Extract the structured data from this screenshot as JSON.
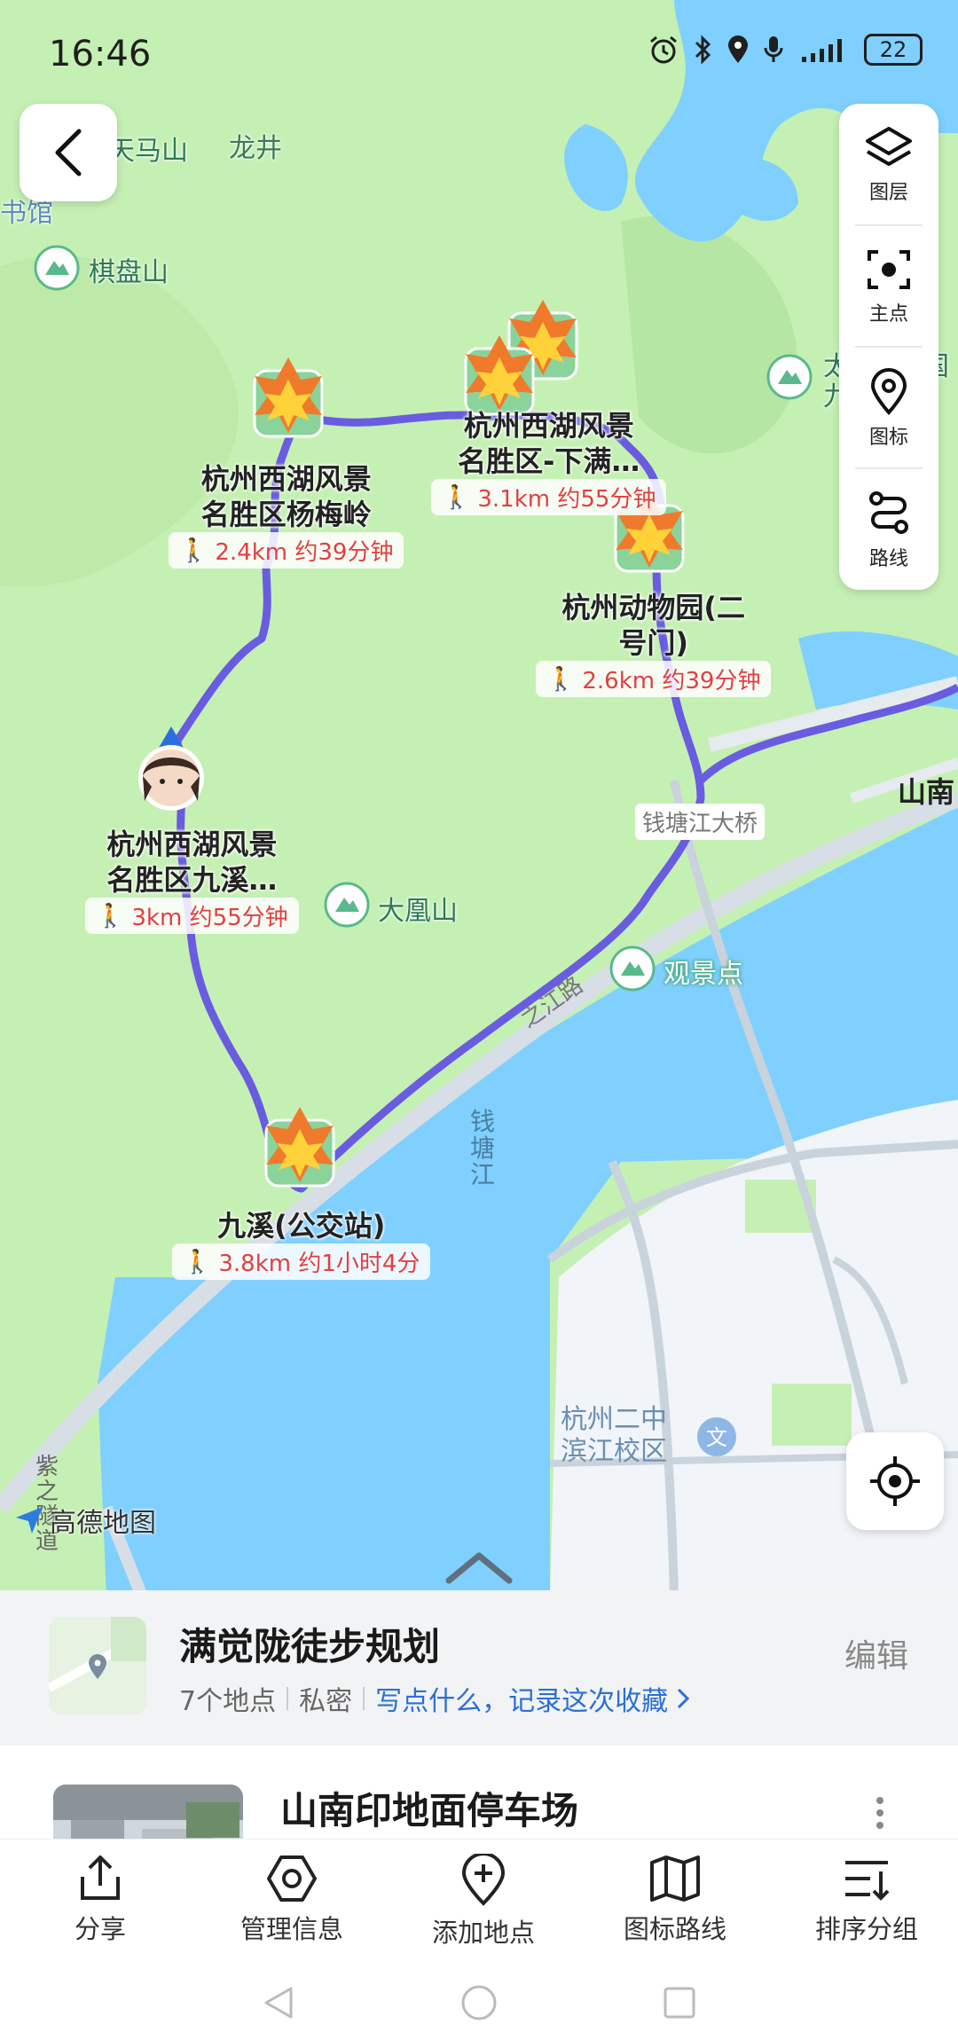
{
  "status_bar": {
    "time": "16:46",
    "battery": "22"
  },
  "toolbar": {
    "items": [
      {
        "label": "图层",
        "icon": "layers-icon"
      },
      {
        "label": "主点",
        "icon": "main-point-icon"
      },
      {
        "label": "图标",
        "icon": "location-pin-icon"
      },
      {
        "label": "路线",
        "icon": "route-icon"
      }
    ]
  },
  "map": {
    "logo": "高德地图",
    "places": [
      {
        "name": "天马山"
      },
      {
        "name": "龙井"
      },
      {
        "name": "书馆"
      },
      {
        "name": "棋盘山"
      },
      {
        "name": "大凰山"
      },
      {
        "name": "观景点"
      },
      {
        "name": "山南"
      },
      {
        "name": "太"
      },
      {
        "name": "九"
      },
      {
        "name": "国"
      },
      {
        "name": "杭州二中滨江校区",
        "line1": "杭州二中",
        "line2": "滨江校区"
      }
    ],
    "roads": [
      "钱塘江大桥",
      "之江路",
      "钱塘江",
      "紫之隧道"
    ],
    "pois": [
      {
        "name1": "杭州西湖风景",
        "name2": "名胜区杨梅岭",
        "dist": "2.4km 约39分钟"
      },
      {
        "name1": "杭州西湖风景",
        "name2": "名胜区-下满…",
        "dist": "3.1km 约55分钟"
      },
      {
        "name1": "杭州动物园(二",
        "name2": "号门)",
        "dist": "2.6km 约39分钟"
      },
      {
        "name1": "杭州西湖风景",
        "name2": "名胜区九溪…",
        "dist": "3km 约55分钟"
      },
      {
        "name1": "九溪(公交站)",
        "name2": "",
        "dist": "3.8km 约1小时4分"
      }
    ]
  },
  "plan": {
    "title": "满觉陇徒步规划",
    "count": "7个地点",
    "privacy": "私密",
    "note_link": "写点什么，记录这次收藏",
    "edit": "编辑"
  },
  "list": {
    "first_item": "山南印地面停车场"
  },
  "bottom_nav": [
    {
      "label": "分享",
      "icon": "share-icon"
    },
    {
      "label": "管理信息",
      "icon": "manage-icon"
    },
    {
      "label": "添加地点",
      "icon": "add-location-icon"
    },
    {
      "label": "图标路线",
      "icon": "map-route-icon"
    },
    {
      "label": "排序分组",
      "icon": "sort-icon"
    }
  ],
  "colors": {
    "land": "#c5f0b4",
    "water": "#7fd0ff",
    "route": "#6a5ce0",
    "urban": "#f1f4f8",
    "road": "#c9d3dc",
    "distance_red": "#e14040",
    "link_blue": "#2b6fd6"
  }
}
